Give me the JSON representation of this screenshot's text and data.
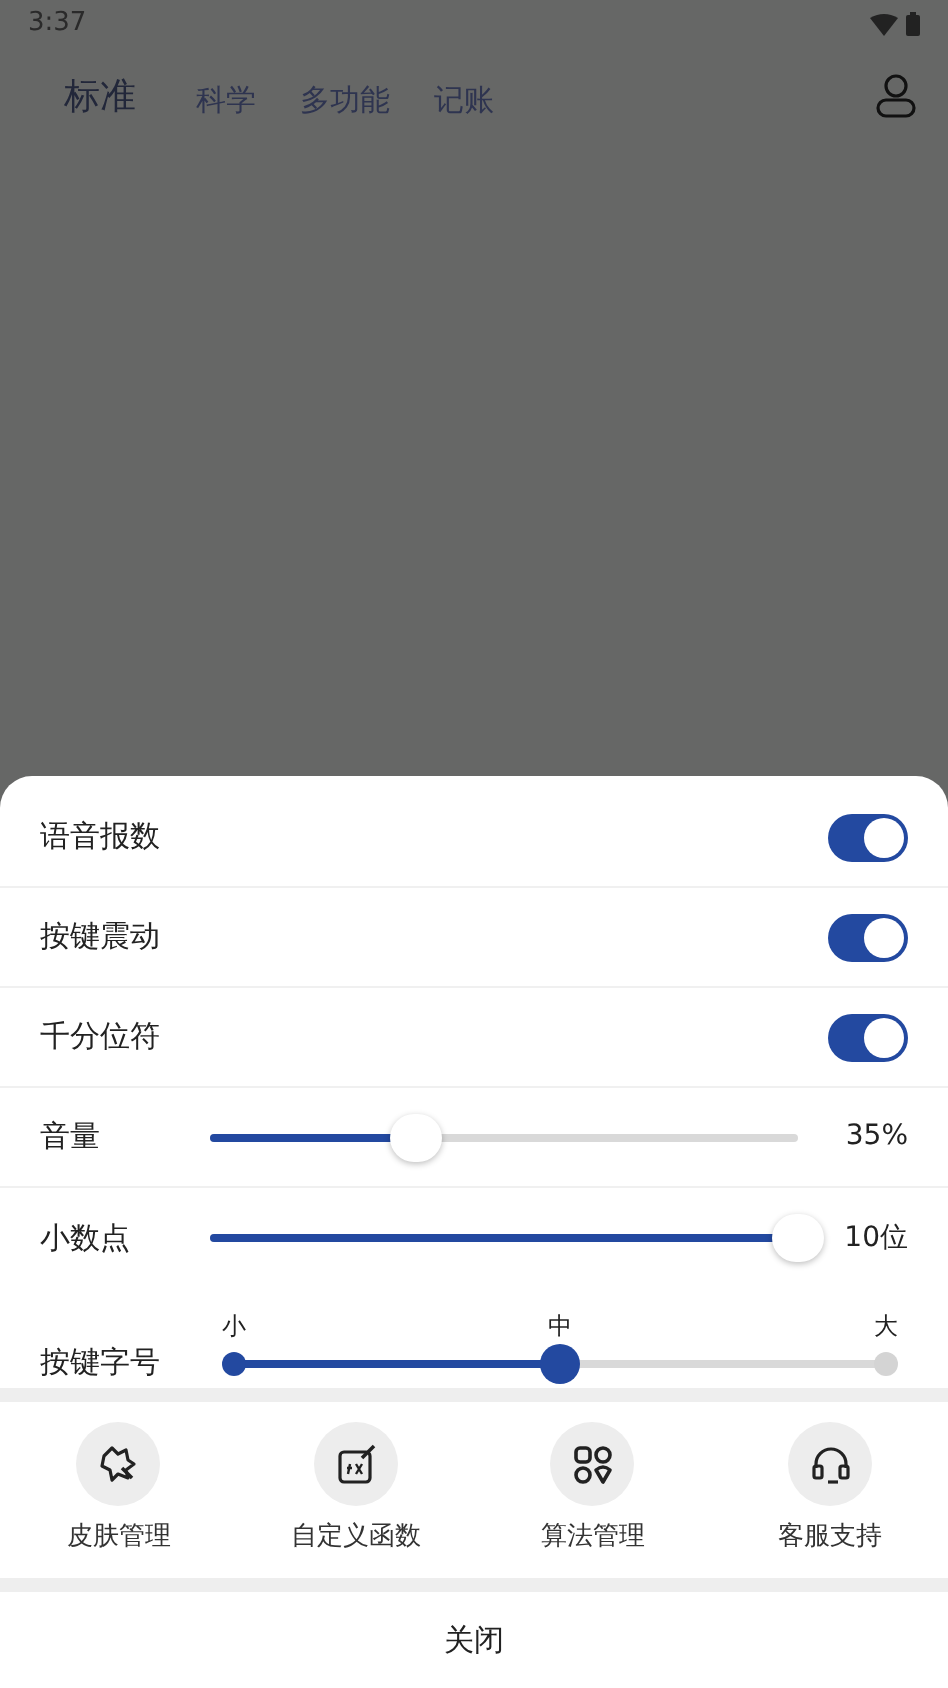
{
  "status_bar": {
    "time": "3:37"
  },
  "tabs": [
    {
      "label": "标准",
      "selected": true
    },
    {
      "label": "科学",
      "selected": false
    },
    {
      "label": "多功能",
      "selected": false
    },
    {
      "label": "记账",
      "selected": false
    }
  ],
  "settings": [
    {
      "kind": "toggle",
      "label": "语音报数",
      "on": true
    },
    {
      "kind": "toggle",
      "label": "按键震动",
      "on": true
    },
    {
      "kind": "toggle",
      "label": "千分位符",
      "on": true
    },
    {
      "kind": "slider",
      "label": "音量",
      "level": 0.35,
      "reading": "35%"
    },
    {
      "kind": "slider",
      "label": "小数点",
      "level": 1,
      "reading": "10位"
    },
    {
      "kind": "steps",
      "label": "按键字号",
      "stops": [
        {
          "label": "小",
          "selected": false
        },
        {
          "label": "中",
          "selected": true
        },
        {
          "label": "大",
          "selected": false
        }
      ]
    }
  ],
  "actions": [
    {
      "kind": "skin",
      "label": "皮肤管理"
    },
    {
      "kind": "function",
      "label": "自定义函数"
    },
    {
      "kind": "algorithm",
      "label": "算法管理"
    },
    {
      "kind": "support",
      "label": "客服支持"
    }
  ],
  "close_button": "关闭"
}
